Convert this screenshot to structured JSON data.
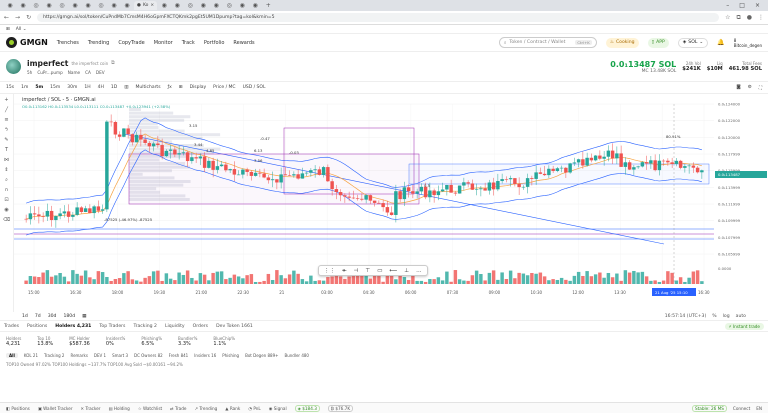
{
  "browser": {
    "url": "https://gmgn.ai/sol/token/CuPndMb7CmsM4H6oGpmFXCTQKmk2pgEt5UM1Dpump?tag=kol&kmin=5",
    "tab_label": "Ko"
  },
  "nav": {
    "brand": "GMGN",
    "links": [
      "Trenches",
      "Trending",
      "CopyTrade",
      "Monitor",
      "Track",
      "Portfolio",
      "Rewards"
    ],
    "search_placeholder": "Token / Contract / Wallet",
    "search_shortcut": "Ctrl+K",
    "cooking_label": "Cooking",
    "app_label": "APP",
    "chain_label": "SOL",
    "account_line1": "8",
    "account_line2": "Bitcoin_degen"
  },
  "token": {
    "name": "imperfect",
    "subtitle": "the imperfect coin",
    "meta": [
      "5h",
      "CuPr...pump",
      "Name",
      "CA",
      "DEV"
    ],
    "price": "0.0₁13487 SOL",
    "mc": "MC 13.48K SOL",
    "stats": [
      {
        "label": "24h Vol",
        "value": "$241K"
      },
      {
        "label": "Liq",
        "value": "$10M"
      },
      {
        "label": "Total Fees",
        "value": "461.98 SOL"
      }
    ]
  },
  "chart_toolbar": {
    "intervals": [
      "15s",
      "1m",
      "5m",
      "15m",
      "30m",
      "1H",
      "4H",
      "1D"
    ],
    "active_interval": "5m",
    "items": [
      "Multicharts",
      "Display",
      "Price / MC",
      "USD / SOL"
    ]
  },
  "chart": {
    "legend": "imperfect / SOL - 5 · GMGN.ai",
    "ohlc": "O0.0₁113162 H0.0₁113534 L0.0₁113111 C0.0₁113487 +0.0₁123941 (+2.58%)",
    "current_price_tag": "0.0₁113487",
    "hover_label": "-87525 (-46.97%) -87525",
    "date_tag": "21 Aug '25  15:10",
    "pct_label": "80.91%",
    "x_ticks": [
      "15:00",
      "16:30",
      "18:00",
      "19:30",
      "21:00",
      "22:30",
      "21",
      "03:00",
      "04:30",
      "06:00",
      "07:30",
      "09:00",
      "10:30",
      "12:00",
      "13:30",
      "15:00",
      "16:30"
    ],
    "y_ticks": [
      "0.0₁124000",
      "0.0₁122000",
      "0.0₁120000",
      "0.0₁117999",
      "0.0₁115999",
      "0.0₁113999",
      "0.0₁111999",
      "0.0₁109999",
      "0.0₁107999",
      "0.0₁105999",
      "0.0000"
    ],
    "labels": [
      "3.15",
      "3.44",
      "4.85",
      "6.13",
      "3.56",
      "-0.03",
      "-0.47",
      "0.5"
    ],
    "colors": {
      "up": "#26a69a",
      "down": "#ef5350",
      "band": "#2962ff",
      "box": "#9c27b0",
      "ma": "#f6a342"
    }
  },
  "ranges": {
    "items": [
      "1d",
      "7d",
      "30d",
      "180d"
    ],
    "clock": "16:57:14 (UTC+3)",
    "opts": [
      "%",
      "log",
      "auto"
    ]
  },
  "bottom_tabs": {
    "items": [
      "Trades",
      "Positions",
      "Holders 4,231",
      "Top Traders",
      "Tracking 2",
      "Liquidity",
      "Orders",
      "Dev Token 1661"
    ],
    "active": "Holders 4,231",
    "instant": "Instant trade"
  },
  "holder_stats": [
    {
      "label": "Holders",
      "value": "4,231"
    },
    {
      "label": "Top 10",
      "value": "13.8%"
    },
    {
      "label": "MC Holder",
      "value": "$587.36"
    },
    {
      "label": "Insiders%",
      "value": "0%"
    },
    {
      "label": "Phishing%",
      "value": "6.5%"
    },
    {
      "label": "Bundler%",
      "value": "3.3%"
    },
    {
      "label": "BlueChip%",
      "value": "1.1%"
    }
  ],
  "filters": [
    "All",
    "KOL 21",
    "Tracking 2",
    "Remarks",
    "DEV 1",
    "Smart 3",
    "DC Owners 82",
    "Fresh 841",
    "Insiders 16",
    "Phishing",
    "Bot Degen 889+",
    "Bundler 480"
  ],
  "top10_line": "TOP10 Owned 97.02%  TOP100 Holdings ~137.7%  TOP100 Avg Sold ~$0.00161  ~94.2%",
  "statusbar": {
    "items": [
      "Positions",
      "Wallet Tracker",
      "Tracker",
      "Holding",
      "Watchlist",
      "Trade",
      "Trending",
      "Rank",
      "PnL",
      "Signal"
    ],
    "sol_price": "$184.3",
    "btc_price": "$76.7K",
    "right": [
      "Stable: 26 MS",
      "Connect",
      "EN"
    ]
  }
}
